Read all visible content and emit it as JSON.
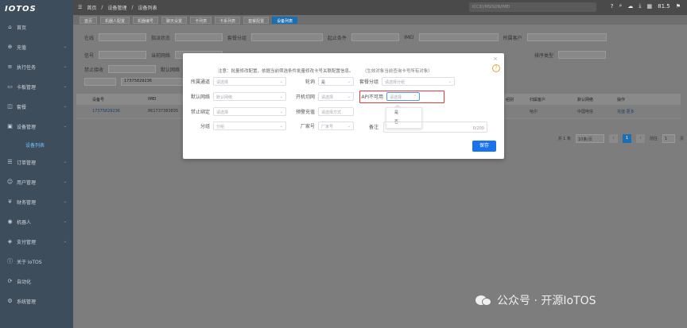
{
  "app": {
    "logo": "IOTOS"
  },
  "sidebar": {
    "items": [
      {
        "label": "首页",
        "icon": "home-icon"
      },
      {
        "label": "充值",
        "icon": "cart-icon"
      },
      {
        "label": "执行任务",
        "icon": "task-icon"
      },
      {
        "label": "卡板管理",
        "icon": "card-icon"
      },
      {
        "label": "套餐",
        "icon": "package-icon"
      },
      {
        "label": "设备管理",
        "icon": "device-icon"
      },
      {
        "label": "订单管理",
        "icon": "order-icon"
      },
      {
        "label": "用户管理",
        "icon": "user-icon"
      },
      {
        "label": "财务管理",
        "icon": "finance-icon"
      },
      {
        "label": "机器人",
        "icon": "robot-icon"
      },
      {
        "label": "支付管理",
        "icon": "pay-icon"
      },
      {
        "label": "关于 IoTOS",
        "icon": "info-icon"
      },
      {
        "label": "自动化",
        "icon": "auto-icon"
      },
      {
        "label": "系统管理",
        "icon": "system-icon"
      }
    ],
    "submenu_active": "设备列表"
  },
  "topbar": {
    "breadcrumbs": [
      "首页",
      "设备管理",
      "设备列表"
    ],
    "search_placeholder": "ICCID/MSISDN/IMEI",
    "balance": "81.5"
  },
  "tabs": [
    "首页",
    "机器人配置",
    "机器编号",
    "聊天设置",
    "卡列表",
    "卡系列表",
    "套餐配置",
    "设备列表"
  ],
  "background": {
    "filters_row1": [
      "在线",
      "指派状态",
      "套餐分组",
      "起止条件",
      "IMEI",
      "所属客户"
    ],
    "filters_row2": [
      "信号",
      "当前网络",
      "排序类型"
    ],
    "filters_row3": [
      "禁止接收",
      "默认网络"
    ],
    "search_value": "17375829236",
    "table_headers": [
      "设备号",
      "IMEI",
      "所属",
      "组别",
      "归属客户",
      "默认网络",
      "操作"
    ],
    "table_row": [
      "17375829236",
      "861737383835",
      "admin",
      "哈尔",
      "中国电信",
      "充值 更多"
    ],
    "pager": {
      "total": "共 1 条",
      "per_page": "10条/页",
      "page": "1",
      "goto": "前往",
      "goto_page": "1",
      "pages": "页"
    }
  },
  "modal": {
    "note": "注意：批量修改配置，依据当前筛选条件批量修改卡号关联配置信息。",
    "note_extra": "（生效对象当前查询卡号所有对象）",
    "fields": {
      "qiye_tongdao": {
        "label": "所属通道",
        "placeholder": "请选择"
      },
      "lunxun": {
        "label": "轮询",
        "value": "是"
      },
      "taocan_fenzu": {
        "label": "套餐分组",
        "placeholder": "请选择分组"
      },
      "moren_wangluo": {
        "label": "默认网络",
        "placeholder": "默认网络"
      },
      "kaiji_qiehuan": {
        "label": "开机切网",
        "placeholder": "请选择"
      },
      "api_unavailable": {
        "label": "API不可用",
        "placeholder": "请选择"
      },
      "jinzhi_jieshou": {
        "label": "禁止绑定",
        "placeholder": "请选择"
      },
      "yujing_fangshi": {
        "label": "预警充值",
        "placeholder": "请选择方式"
      },
      "fenzu": {
        "label": "分组",
        "placeholder": "分组"
      },
      "changjia": {
        "label": "厂家号",
        "placeholder": "厂家号"
      },
      "beizhu": {
        "label": "备注",
        "counter": "0/200"
      }
    },
    "dropdown_options": [
      "是",
      "否"
    ],
    "save_label": "保存",
    "close_label": "×",
    "help_label": "?"
  },
  "watermark": {
    "text": "公众号 · 开源IoTOS"
  }
}
